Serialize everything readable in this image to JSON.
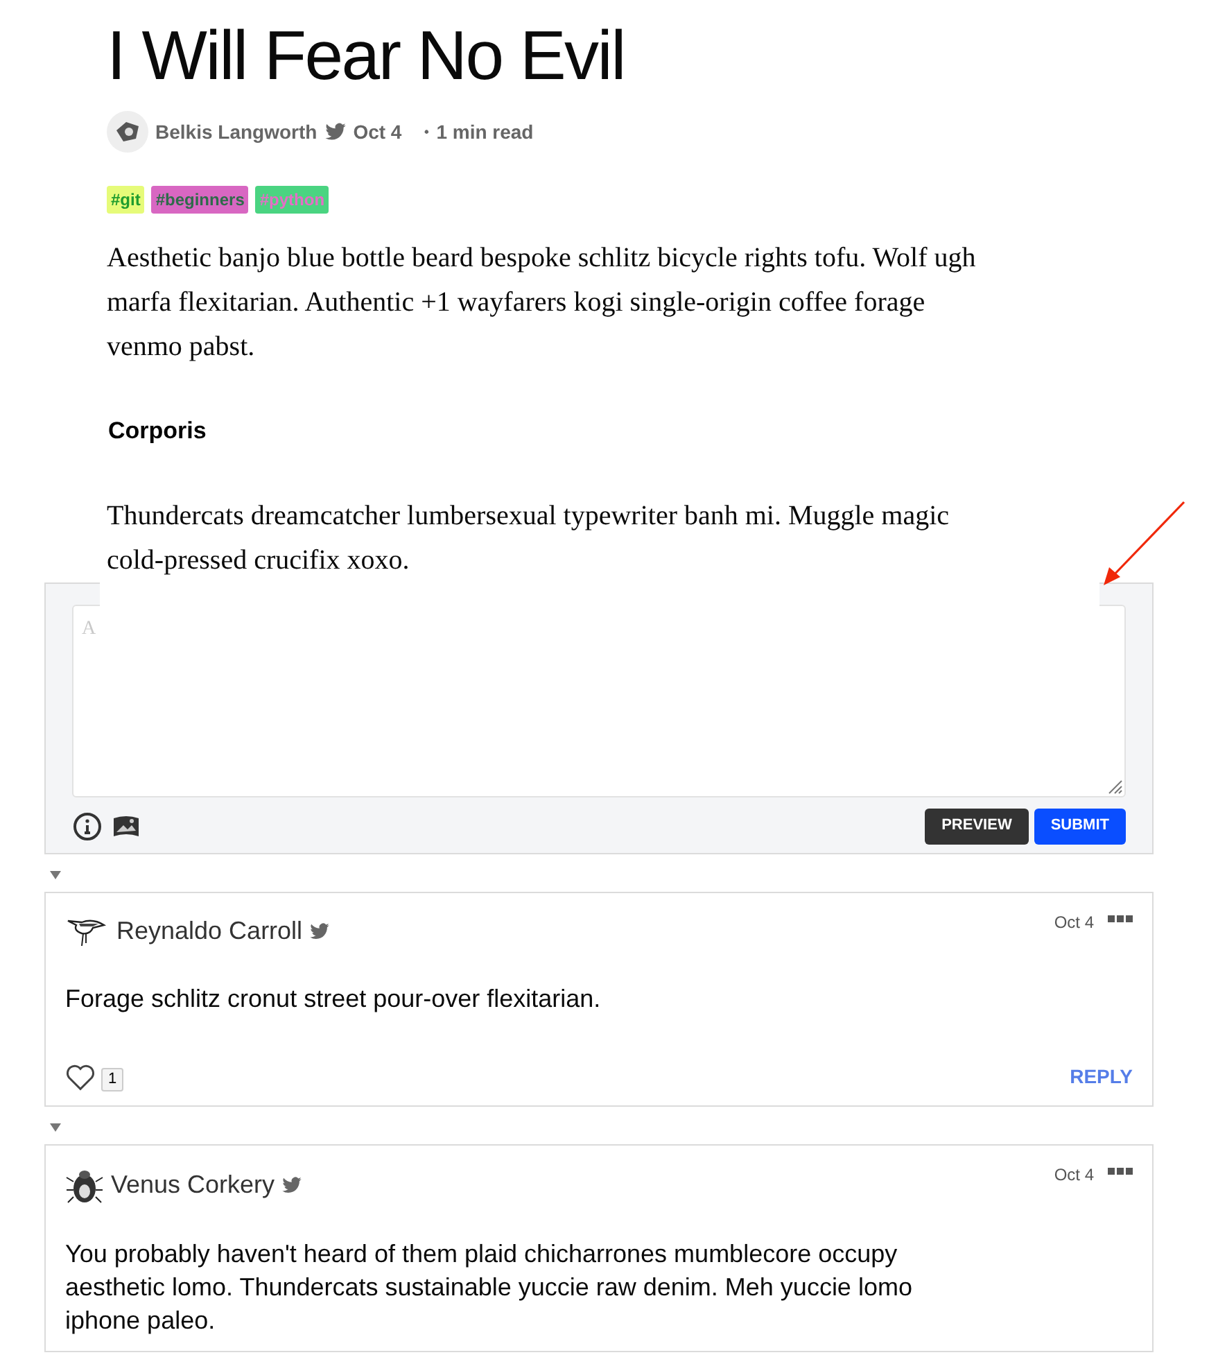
{
  "article": {
    "title": "I Will Fear No Evil",
    "author": "Belkis Langworth",
    "date": "Oct 4",
    "read_time": "・1 min read",
    "tags": [
      {
        "label": "#git",
        "color": "#e6fb79"
      },
      {
        "label": "#beginners",
        "color": "#d867c2"
      },
      {
        "label": "#python",
        "color": "#4ad481"
      }
    ],
    "blocks": [
      {
        "kind": "paragraph",
        "text": "Aesthetic banjo blue bottle beard bespoke schlitz bicycle rights tofu. Wolf ugh marfa flexitarian. Authentic +1 wayfarers kogi single-origin coffee forage venmo pabst."
      },
      {
        "kind": "heading",
        "text": "Corporis"
      },
      {
        "kind": "paragraph",
        "text": "Thundercats dreamcatcher lumbersexual typewriter banh mi. Muggle magic cold-pressed crucifix xoxo."
      }
    ]
  },
  "comment_form": {
    "placeholder": "A",
    "buttons": [
      {
        "label": "PREVIEW",
        "kind": "secondary"
      },
      {
        "label": "SUBMIT",
        "kind": "primary"
      }
    ]
  },
  "comments": [
    {
      "author": "Reynaldo Carroll",
      "avatar": {
        "kind": "bird"
      },
      "date": "Oct 4",
      "text": "Forage schlitz cronut street pour-over flexitarian.",
      "likes": "1",
      "reply": "REPLY"
    },
    {
      "author": "Venus Corkery",
      "avatar": {
        "kind": "beetle"
      },
      "date": "Oct 4",
      "text": "You probably haven't heard of them plaid chicharrones mumblecore occupy aesthetic lomo. Thundercats sustainable yuccie raw denim. Meh yuccie lomo iphone paleo."
    }
  ]
}
